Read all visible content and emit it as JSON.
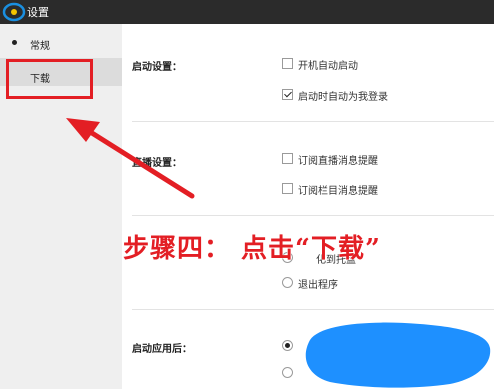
{
  "window": {
    "title": "设置"
  },
  "sidebar": {
    "items": [
      {
        "label": "常规"
      },
      {
        "label": "下载"
      }
    ]
  },
  "sections": {
    "startup": {
      "label": "启动设置：",
      "options": [
        {
          "text": "开机自动启动",
          "checked": false
        },
        {
          "text": "启动时自动为我登录",
          "checked": true
        }
      ]
    },
    "live": {
      "label": "直播设置：",
      "options": [
        {
          "text": "订阅直播消息提醒",
          "checked": false
        },
        {
          "text": "订阅栏目消息提醒",
          "checked": false
        }
      ]
    },
    "close": {
      "options": [
        {
          "text": "化到托盘",
          "selected": false
        },
        {
          "text": "退出程序",
          "selected": false
        }
      ]
    },
    "after_launch": {
      "label": "启动应用后：",
      "options": [
        {
          "selected": true
        },
        {
          "selected": false
        }
      ]
    }
  },
  "annotation": {
    "step_text": "步骤四： 点击“下载”",
    "color": "#e31e24"
  },
  "colors": {
    "titlebar": "#2b2b2b",
    "sidebar": "#efefef",
    "highlight": "#e31e24",
    "redaction_blob": "#1e90ff"
  }
}
